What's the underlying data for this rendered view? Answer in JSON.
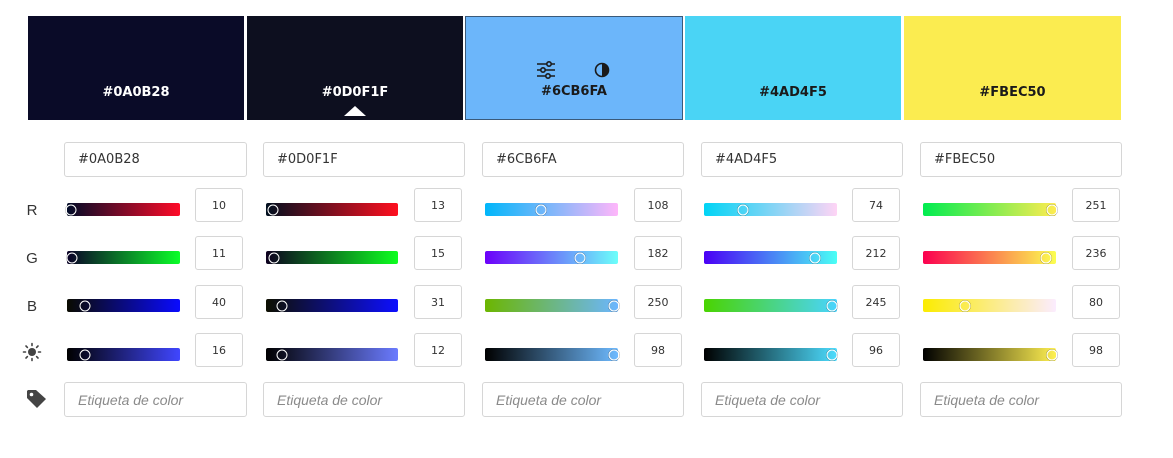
{
  "colors": [
    {
      "hex": "#0A0B28",
      "r": "10",
      "g": "11",
      "b": "40",
      "brightness": "16",
      "label_placeholder": "Etiqueta de color",
      "text_color": "#ffffff"
    },
    {
      "hex": "#0D0F1F",
      "r": "13",
      "g": "15",
      "b": "31",
      "brightness": "12",
      "label_placeholder": "Etiqueta de color",
      "text_color": "#ffffff"
    },
    {
      "hex": "#6CB6FA",
      "r": "108",
      "g": "182",
      "b": "250",
      "brightness": "98",
      "label_placeholder": "Etiqueta de color",
      "text_color": "#1a1a1a"
    },
    {
      "hex": "#4AD4F5",
      "r": "74",
      "g": "212",
      "b": "245",
      "brightness": "96",
      "label_placeholder": "Etiqueta de color",
      "text_color": "#1a1a1a"
    },
    {
      "hex": "#FBEC50",
      "r": "251",
      "g": "236",
      "b": "80",
      "brightness": "98",
      "label_placeholder": "Etiqueta de color",
      "text_color": "#1a1a1a"
    }
  ],
  "selected_index": 1,
  "active_index": 2,
  "row_labels": {
    "r": "R",
    "g": "G",
    "b": "B"
  },
  "icons": {
    "brightness": "sun-icon",
    "tag": "tag-icon",
    "adjust": "sliders-icon",
    "contrast": "contrast-icon"
  }
}
